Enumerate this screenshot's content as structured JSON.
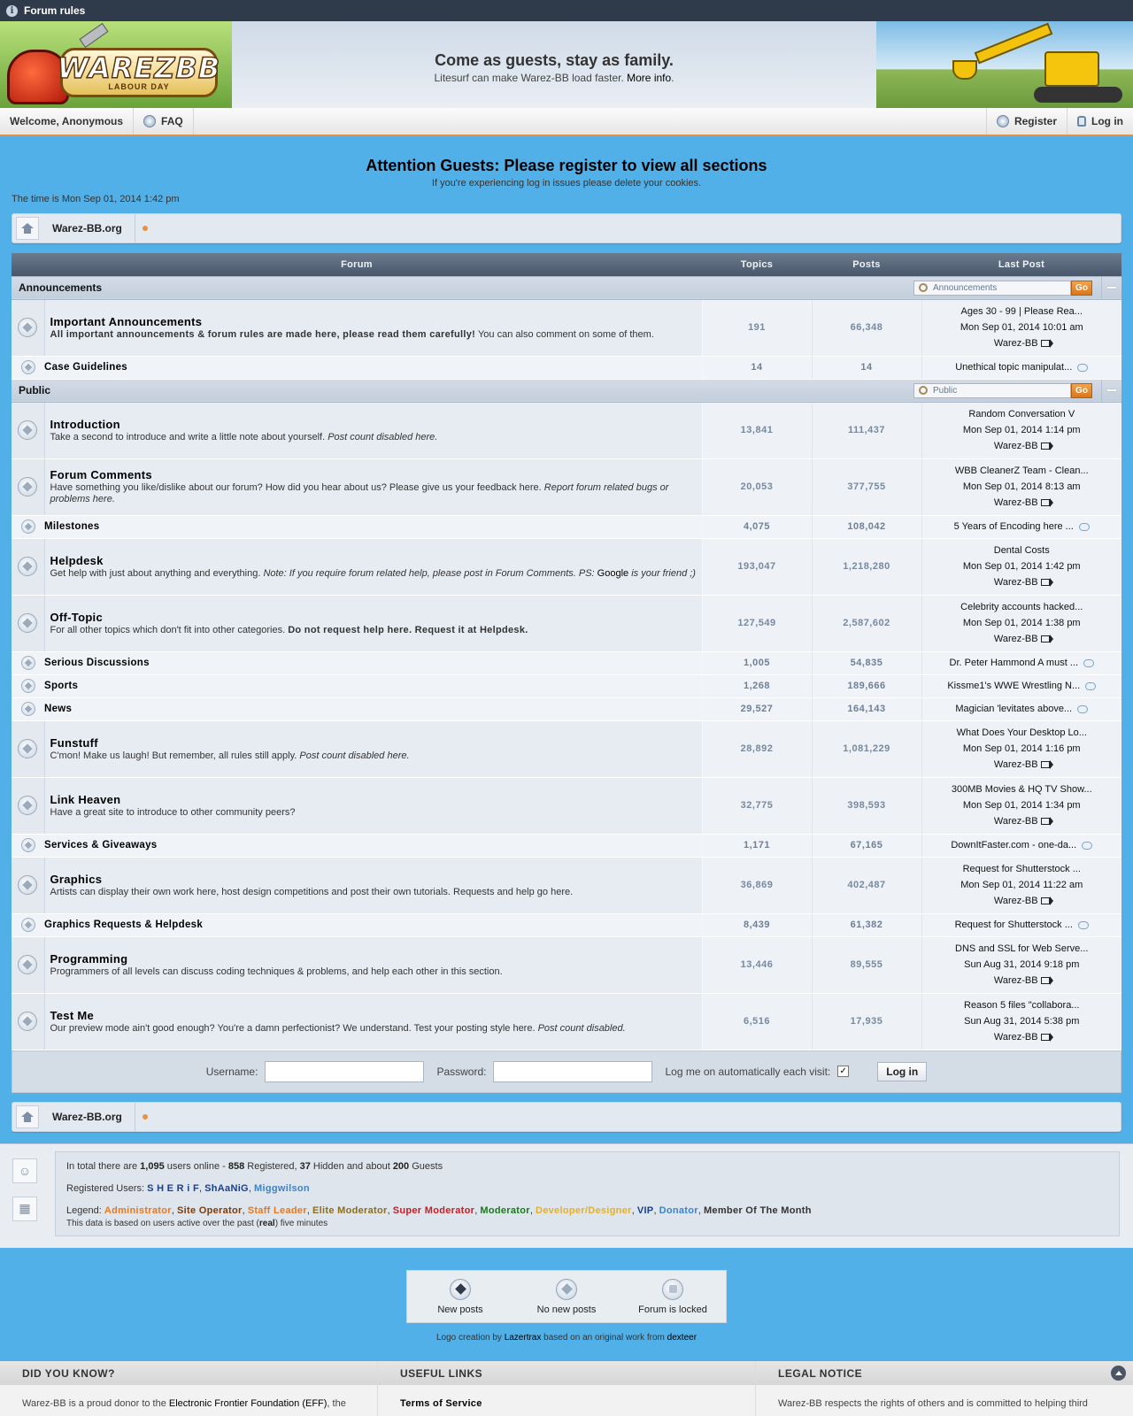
{
  "topbar": {
    "icon": "info-icon",
    "title": "Forum rules"
  },
  "header": {
    "logo_text": "WAREZBB",
    "logo_sub": "LABOUR DAY",
    "slogan": "Come as guests, stay as family.",
    "sub_prefix": "Litesurf can make Warez-BB load faster.",
    "more_info": "More info",
    "sub_suffix": "."
  },
  "nav": {
    "welcome": "Welcome, Anonymous",
    "faq": "FAQ",
    "register": "Register",
    "login": "Log in"
  },
  "attention": {
    "title": "Attention Guests: Please register to view all sections",
    "sub": "If you're experiencing log in issues please delete your cookies."
  },
  "time": "The time is Mon Sep 01, 2014 1:42 pm",
  "breadcrumb": {
    "label": "Warez-BB.org"
  },
  "table_headers": {
    "forum": "Forum",
    "topics": "Topics",
    "posts": "Posts",
    "last_post": "Last Post"
  },
  "categories": {
    "announcements": {
      "name": "Announcements",
      "jump": "Announcements",
      "go": "Go"
    },
    "public": {
      "name": "Public",
      "jump": "Public",
      "go": "Go"
    }
  },
  "forums": {
    "important": {
      "name": "Important Announcements",
      "bold": "All important announcements & forum rules are made here, please read them carefully!",
      "desc": " You can also comment on some of them.",
      "topics": "191",
      "posts": "66,348",
      "lp_title": "Ages 30 - 99 | Please Rea...",
      "lp_time": "Mon Sep 01, 2014 10:01 am",
      "lp_user": "Warez-BB"
    },
    "case": {
      "name": "Case Guidelines",
      "topics": "14",
      "posts": "14",
      "lp_title": "Unethical topic manipulat..."
    },
    "intro": {
      "name": "Introduction",
      "desc": "Take a second to introduce and write a little note about yourself. ",
      "em": "Post count disabled here.",
      "topics": "13,841",
      "posts": "111,437",
      "lp_title": "Random Conversation V",
      "lp_time": "Mon Sep 01, 2014 1:14 pm",
      "lp_user": "Warez-BB"
    },
    "comments": {
      "name": "Forum Comments",
      "desc": "Have something you like/dislike about our forum? How did you hear about us? Please give us your feedback here. ",
      "em": "Report forum related bugs or problems here.",
      "topics": "20,053",
      "posts": "377,755",
      "lp_title": "WBB CleanerZ Team - Clean...",
      "lp_time": "Mon Sep 01, 2014 8:13 am",
      "lp_user": "Warez-BB"
    },
    "milestones": {
      "name": "Milestones",
      "topics": "4,075",
      "posts": "108,042",
      "lp_title": "5 Years of Encoding here ..."
    },
    "helpdesk": {
      "name": "Helpdesk",
      "desc": "Get help with just about anything and everything. ",
      "em1": "Note: If you require forum related help, please post in Forum Comments. PS: ",
      "google": "Google",
      "em2": " is your friend ;)",
      "topics": "193,047",
      "posts": "1,218,280",
      "lp_title": "Dental Costs",
      "lp_time": "Mon Sep 01, 2014 1:42 pm",
      "lp_user": "Warez-BB"
    },
    "offtopic": {
      "name": "Off-Topic",
      "desc": "For all other topics which don't fit into other categories. ",
      "bold": "Do not request help here. Request it at Helpdesk.",
      "topics": "127,549",
      "posts": "2,587,602",
      "lp_title": "Celebrity accounts hacked...",
      "lp_time": "Mon Sep 01, 2014 1:38 pm",
      "lp_user": "Warez-BB"
    },
    "serious": {
      "name": "Serious Discussions",
      "topics": "1,005",
      "posts": "54,835",
      "lp_title": "Dr. Peter Hammond A must ..."
    },
    "sports": {
      "name": "Sports",
      "topics": "1,268",
      "posts": "189,666",
      "lp_title": "Kissme1's WWE Wrestling N..."
    },
    "news": {
      "name": "News",
      "topics": "29,527",
      "posts": "164,143",
      "lp_title": "Magician 'levitates above..."
    },
    "funstuff": {
      "name": "Funstuff",
      "desc": "C'mon! Make us laugh! But remember, all rules still apply. ",
      "em": "Post count disabled here.",
      "topics": "28,892",
      "posts": "1,081,229",
      "lp_title": "What Does Your Desktop Lo...",
      "lp_time": "Mon Sep 01, 2014 1:16 pm",
      "lp_user": "Warez-BB"
    },
    "link": {
      "name": "Link Heaven",
      "desc": "Have a great site to introduce to other community peers?",
      "topics": "32,775",
      "posts": "398,593",
      "lp_title": "300MB Movies & HQ TV Show...",
      "lp_time": "Mon Sep 01, 2014 1:34 pm",
      "lp_user": "Warez-BB"
    },
    "services": {
      "name": "Services & Giveaways",
      "topics": "1,171",
      "posts": "67,165",
      "lp_title": "DownItFaster.com - one-da..."
    },
    "graphics": {
      "name": "Graphics",
      "desc": "Artists can display their own work here, host design competitions and post their own tutorials. Requests and help go here.",
      "topics": "36,869",
      "posts": "402,487",
      "lp_title": "Request for Shutterstock ...",
      "lp_time": "Mon Sep 01, 2014 11:22 am",
      "lp_user": "Warez-BB"
    },
    "gfxreq": {
      "name": "Graphics Requests & Helpdesk",
      "topics": "8,439",
      "posts": "61,382",
      "lp_title": "Request for Shutterstock ..."
    },
    "programming": {
      "name": "Programming",
      "desc": "Programmers of all levels can discuss coding techniques & problems, and help each other in this section.",
      "topics": "13,446",
      "posts": "89,555",
      "lp_title": "DNS and SSL for Web Serve...",
      "lp_time": "Sun Aug 31, 2014 9:18 pm",
      "lp_user": "Warez-BB"
    },
    "testme": {
      "name": "Test Me",
      "desc": "Our preview mode ain't good enough? You're a damn perfectionist? We understand. Test your posting style here. ",
      "em": "Post count disabled.",
      "topics": "6,516",
      "posts": "17,935",
      "lp_title": "Reason 5 files \"collabora...",
      "lp_time": "Sun Aug 31, 2014 5:38 pm",
      "lp_user": "Warez-BB"
    }
  },
  "login": {
    "username_label": "Username:",
    "password_label": "Password:",
    "remember_label": "Log me on automatically each visit:",
    "remember_checked": "✓",
    "button": "Log in"
  },
  "online": {
    "t1": "In total there are ",
    "total": "1,095",
    "t2": " users online - ",
    "registered": "858",
    "t3": " Registered, ",
    "hidden": "37",
    "t4": " Hidden and about ",
    "guests": "200",
    "t5": " Guests",
    "reg_label": "Registered Users: ",
    "users": [
      {
        "name": "S H E R i F",
        "color": "#1b3f8f"
      },
      {
        "name": "ShAaNiG",
        "color": "#1b3f8f"
      },
      {
        "name": "Miggwilson",
        "color": "#3e82c9"
      }
    ],
    "legend_label": "Legend: ",
    "legend": [
      {
        "name": "Administrator",
        "color": "#e8781e"
      },
      {
        "name": "Site Operator",
        "color": "#7d3b0a"
      },
      {
        "name": "Staff Leader",
        "color": "#e8781e"
      },
      {
        "name": "Elite Moderator",
        "color": "#8a6d1e"
      },
      {
        "name": "Super Moderator",
        "color": "#c81d25"
      },
      {
        "name": "Moderator",
        "color": "#197a1b"
      },
      {
        "name": "Developer/Designer",
        "color": "#e2b12c"
      },
      {
        "name": "VIP",
        "color": "#1b3f8f"
      },
      {
        "name": "Donator",
        "color": "#3e82c9"
      },
      {
        "name": "Member Of The Month",
        "color": "#333333"
      }
    ],
    "note_pre": "This data is based on users active over the past (",
    "note_real": "real",
    "note_post": ") five minutes"
  },
  "icon_legend": {
    "new": "New posts",
    "nonew": "No new posts",
    "locked": "Forum is locked"
  },
  "credits": {
    "pre": "Logo creation by ",
    "author": "Lazertrax",
    "mid": " based on an original work from ",
    "orig": "dexteer"
  },
  "footer": {
    "dyk_title": "DID YOU KNOW?",
    "dyk_pre": "Warez-BB is a proud donor to the ",
    "dyk_link": "Electronic Frontier Foundation (EFF)",
    "dyk_post": ", the",
    "links_title": "USEFUL LINKS",
    "tos": "Terms of Service",
    "legal_title": "LEGAL NOTICE",
    "legal_text": "Warez-BB respects the rights of others and is committed to helping third"
  }
}
